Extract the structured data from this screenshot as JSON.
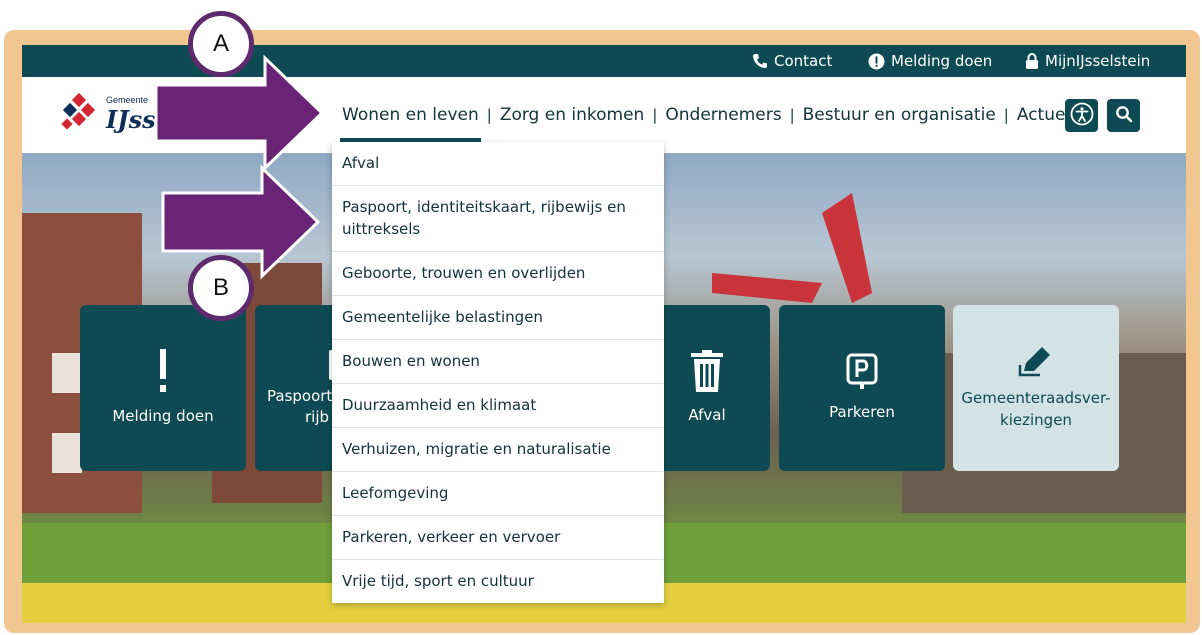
{
  "topbar": {
    "contact": "Contact",
    "melding": "Melding doen",
    "mijn": "MijnIJsselstein"
  },
  "logo": {
    "name": "IJsselstein",
    "sub": "Gemeente"
  },
  "nav": {
    "items": [
      "Wonen en leven",
      "Zorg en inkomen",
      "Ondernemers",
      "Bestuur en organisatie",
      "Actueel"
    ],
    "separator": "|"
  },
  "dropdown": {
    "items": [
      "Afval",
      "Paspoort, identiteitskaart, rijbewijs en uittreksels",
      "Geboorte, trouwen en overlijden",
      "Gemeentelijke belastingen",
      "Bouwen en wonen",
      "Duurzaamheid en klimaat",
      "Verhuizen, migratie en naturalisatie",
      "Leefomgeving",
      "Parkeren, verkeer en vervoer",
      "Vrije tijd, sport en cultuur"
    ]
  },
  "tiles": {
    "melding": "Melding doen",
    "paspoort_a": "Paspoort",
    "paspoort_b": "rijb",
    "afval": "Afval",
    "parkeren": "Parkeren",
    "raad_a": "Gemeenteraadsver-",
    "raad_b": "kiezingen"
  },
  "annotations": {
    "a": "A",
    "b": "B",
    "arrow_color": "#6a2476"
  },
  "colors": {
    "brand": "#0e4a53",
    "frame": "#f2c690",
    "logo_red": "#d32630",
    "logo_navy": "#0e2d57"
  },
  "icons": [
    "phone-icon",
    "alert-icon",
    "lock-icon",
    "accessibility-icon",
    "search-icon",
    "exclamation-icon",
    "document-icon",
    "trash-icon",
    "parking-icon",
    "pencil-icon"
  ]
}
